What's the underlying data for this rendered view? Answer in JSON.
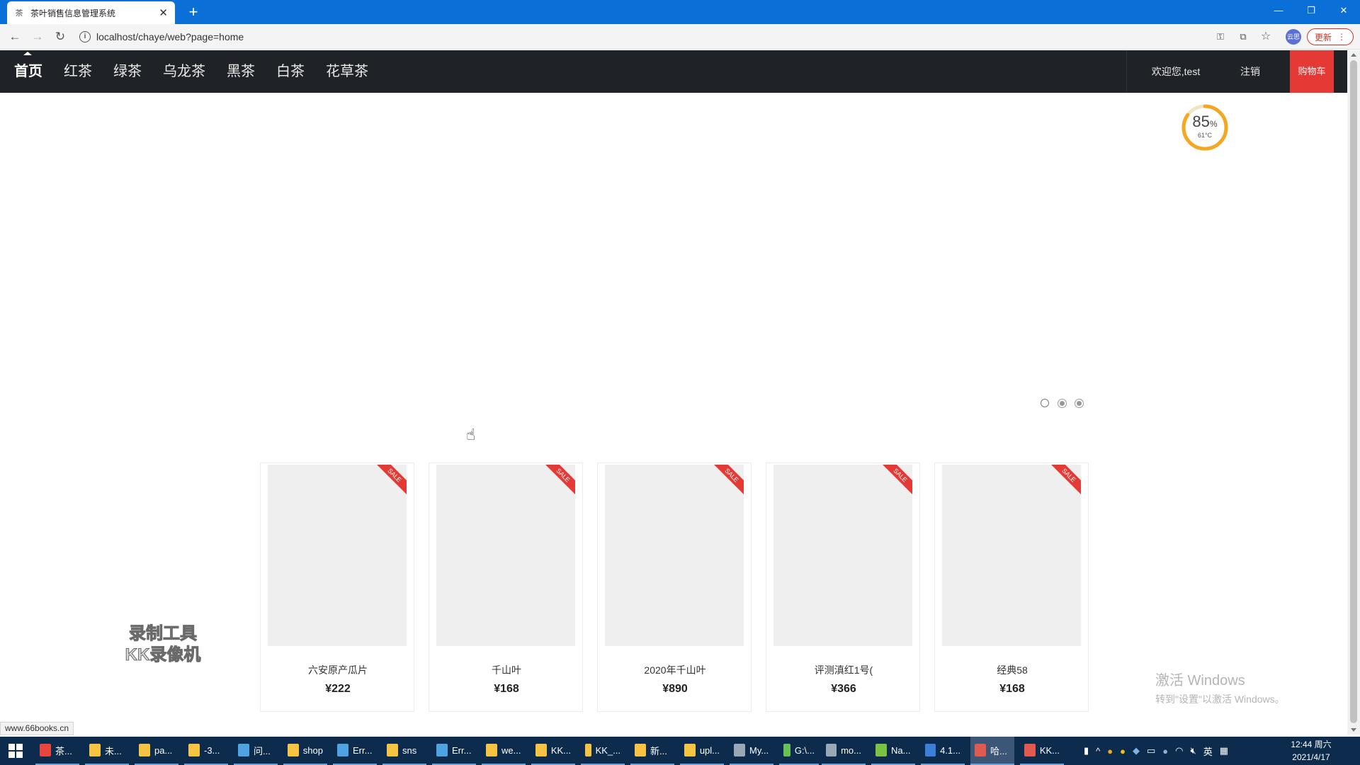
{
  "browser": {
    "tab_title": "茶叶销售信息管理系统",
    "tab_favicon": "茶",
    "url": "localhost/chaye/web?page=home",
    "update_label": "更新",
    "profile_label": "云思"
  },
  "nav": {
    "items": [
      "首页",
      "红茶",
      "绿茶",
      "乌龙茶",
      "黑茶",
      "白茶",
      "花草茶"
    ],
    "active_index": 0,
    "welcome": "欢迎您,test",
    "logout": "注销",
    "cart": "购物车"
  },
  "widget": {
    "percent": "85",
    "percent_unit": "%",
    "temperature": "61°C",
    "percent_value": 0.85,
    "ring_color": "#f5a623"
  },
  "carousel": {
    "dot_count": 3,
    "active_dot": 0
  },
  "products": [
    {
      "name": "六安原产瓜片",
      "price": "¥222",
      "badge": "SALE"
    },
    {
      "name": "千山叶",
      "price": "¥168",
      "badge": "SALE"
    },
    {
      "name": "2020年千山叶",
      "price": "¥890",
      "badge": "SALE"
    },
    {
      "name": "评测滇红1号(",
      "price": "¥366",
      "badge": "SALE"
    },
    {
      "name": "经典58",
      "price": "¥168",
      "badge": "SALE"
    }
  ],
  "watermark": {
    "line1": "录制工具",
    "line2": "KK录像机"
  },
  "windows_activation": {
    "title": "激活 Windows",
    "subtitle": "转到\"设置\"以激活 Windows。"
  },
  "status_url": "www.66books.cn",
  "taskbar": {
    "apps": [
      {
        "label": "茶...",
        "color": "#e8453c",
        "active": false
      },
      {
        "label": "未...",
        "color": "#f6c343",
        "active": false
      },
      {
        "label": "pa...",
        "color": "#f6c343",
        "active": false
      },
      {
        "label": "-3...",
        "color": "#f6c343",
        "active": false
      },
      {
        "label": "问...",
        "color": "#4fa3e0",
        "active": false
      },
      {
        "label": "shop",
        "color": "#f6c343",
        "active": false
      },
      {
        "label": "Err...",
        "color": "#4fa3e0",
        "active": false
      },
      {
        "label": "sns",
        "color": "#f6c343",
        "active": false
      },
      {
        "label": "Err...",
        "color": "#4fa3e0",
        "active": false
      },
      {
        "label": "we...",
        "color": "#f6c343",
        "active": false
      },
      {
        "label": "KK...",
        "color": "#f6c343",
        "active": false
      },
      {
        "label": "KK_...",
        "color": "#f6c343",
        "active": false
      },
      {
        "label": "新...",
        "color": "#f6c343",
        "active": false
      },
      {
        "label": "upl...",
        "color": "#f6c343",
        "active": false
      },
      {
        "label": "My...",
        "color": "#9aa7b5",
        "active": false
      },
      {
        "label": "G:\\...",
        "color": "#6bbf59",
        "active": false
      },
      {
        "label": "mo...",
        "color": "#9aa7b5",
        "active": false
      },
      {
        "label": "Na...",
        "color": "#7bc142",
        "active": false
      },
      {
        "label": "4.1...",
        "color": "#3c7fd8",
        "active": false
      },
      {
        "label": "哈...",
        "color": "#e05a4f",
        "active": true
      },
      {
        "label": "KK...",
        "color": "#e05a4f",
        "active": false
      }
    ],
    "ime": "英",
    "time": "12:44 周六",
    "date": "2021/4/17"
  }
}
